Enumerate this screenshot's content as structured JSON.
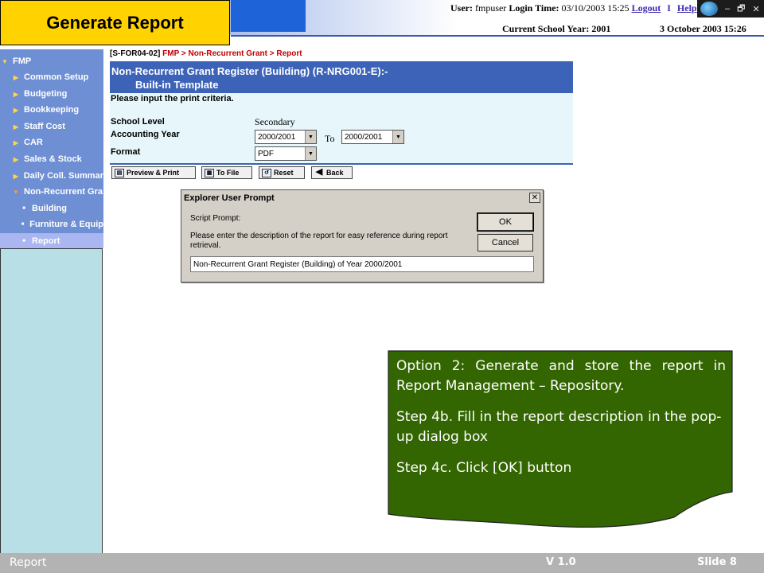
{
  "title": "Generate Report",
  "header": {
    "user_label": "User:",
    "user_value": "fmpuser",
    "login_label": "Login Time:",
    "login_value": "03/10/2003 15:25",
    "logout_link": "Logout",
    "help_link": "Help",
    "school_year": "Current School Year: 2001",
    "current_date": "3 October 2003 15:26",
    "window_controls": [
      "–",
      "🗗",
      "✕"
    ]
  },
  "sidebar": {
    "root": "FMP",
    "items": [
      {
        "label": "Common Setup"
      },
      {
        "label": "Budgeting"
      },
      {
        "label": "Bookkeeping"
      },
      {
        "label": "Staff Cost"
      },
      {
        "label": "CAR"
      },
      {
        "label": "Sales & Stock"
      },
      {
        "label": "Daily Coll. Summar"
      },
      {
        "label": "Non-Recurrent Gra"
      }
    ],
    "subitems": [
      {
        "label": "Building"
      },
      {
        "label": "Furniture & Equip"
      },
      {
        "label": "Report"
      }
    ]
  },
  "breadcrumb": {
    "code": "[S-FOR04-02]",
    "path1": "FMP",
    "path2": "Non-Recurrent Grant",
    "path3": "Report",
    "sep": ">"
  },
  "form": {
    "header_line1": "Non-Recurrent Grant Register (Building) (R-NRG001-E):-",
    "header_line2": "Built-in Template",
    "instruction": "Please input the print criteria.",
    "school_level_label": "School Level",
    "school_level_value": "Secondary",
    "accounting_year_label": "Accounting Year",
    "year_from": "2000/2001",
    "to_label": "To",
    "year_to": "2000/2001",
    "format_label": "Format",
    "format_value": "PDF"
  },
  "toolbar": {
    "preview_print": "Preview & Print",
    "to_file": "To File",
    "reset": "Reset",
    "back": "Back"
  },
  "dialog": {
    "title": "Explorer User Prompt",
    "close": "✕",
    "prompt_label": "Script Prompt:",
    "description": "Please enter the description of the report for easy reference during report retrieval.",
    "input_value": "Non-Recurrent Grant Register (Building) of Year 2000/2001",
    "ok": "OK",
    "cancel": "Cancel"
  },
  "callout": {
    "line1": "Option 2: Generate and store the report in Report Management – Repository.",
    "line2": "Step 4b. Fill in the report description in the pop-up dialog box",
    "line3": "Step 4c. Click [OK] button",
    "bg_color": "#336600"
  },
  "footer": {
    "left": "Report",
    "version": "V 1.0",
    "slide": "Slide 8"
  }
}
